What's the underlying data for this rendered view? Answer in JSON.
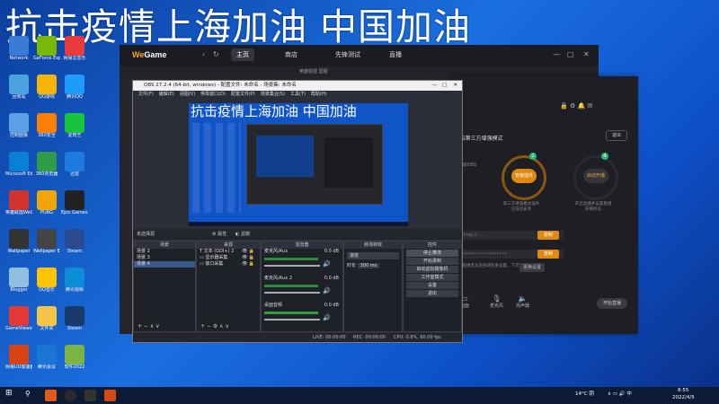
{
  "banner": "抗击疫情上海加油 中国加油",
  "desktop_icons": [
    {
      "label": "Network"
    },
    {
      "label": "GeForce Experience"
    },
    {
      "label": "网易云音乐"
    },
    {
      "label": "回收站"
    },
    {
      "label": "QQ游戏"
    },
    {
      "label": "腾讯QQ"
    },
    {
      "label": "控制面板"
    },
    {
      "label": "360安全"
    },
    {
      "label": "爱奇艺"
    },
    {
      "label": "Microsoft Edge"
    },
    {
      "label": "360浏览器"
    },
    {
      "label": "迅雷"
    },
    {
      "label": "英雄联盟WeGame"
    },
    {
      "label": "PUBG"
    },
    {
      "label": "Epic Games Launcher"
    },
    {
      "label": "Wallpaper"
    },
    {
      "label": "Wallpaper Engine"
    },
    {
      "label": "Steam"
    },
    {
      "label": "Blogger"
    },
    {
      "label": "QQ音乐"
    },
    {
      "label": "腾讯视频"
    },
    {
      "label": "GameViewer"
    },
    {
      "label": "文件夹"
    },
    {
      "label": "Steam"
    },
    {
      "label": "网易UU加速器"
    },
    {
      "label": "腾讯会议"
    },
    {
      "label": "软件2022"
    }
  ],
  "wegame": {
    "logo_we": "We",
    "logo_game": "Game",
    "tabs": [
      {
        "label": "主页"
      },
      {
        "label": "商店"
      },
      {
        "label": "先锋测试"
      },
      {
        "label": "直播"
      }
    ],
    "sub_label": "英雄联盟 国服",
    "controls": [
      "—",
      "□",
      "✕"
    ]
  },
  "panel": {
    "title": "OBS第三方增强模式",
    "exit": "退出",
    "steps": [
      {
        "num": "2",
        "label": "安装插件",
        "desc": "第三方增强模式插件\n已成功安装"
      },
      {
        "num": "4",
        "label": "启动开播",
        "desc": "开启直播并设置直播\n开播状态"
      }
    ],
    "step1_desc": "开启OBS",
    "server_placeholder": "rtmp://....",
    "key_placeholder": "•••••••••••••••••",
    "copy1": "复制",
    "copy2": "复制",
    "hint": "若直播无法连接请检查设置，下次无需重复复制",
    "settings_btn": "更换设置",
    "footer": [
      {
        "label": "画面"
      },
      {
        "label": "麦克风"
      },
      {
        "label": "扬声器"
      }
    ],
    "start": "开始直播"
  },
  "obs": {
    "title": "OBS 27.2.4 (64-bit, windows) - 配置文件: 未命名 - 场景集: 未命名",
    "menu": [
      "文件(F)",
      "编辑(E)",
      "视图(V)",
      "停靠窗口(D)",
      "配置文件(P)",
      "场景集合(S)",
      "工具(T)",
      "帮助(H)"
    ],
    "preview_banner": "抗击疫情上海加油 中国加油",
    "bar_left": "未选择源",
    "bar_props": "属性",
    "bar_filters": "滤镜",
    "docks": {
      "scenes": {
        "title": "场景",
        "items": [
          "场景 2",
          "场景 3",
          "场景 4"
        ]
      },
      "sources": {
        "title": "来源",
        "items": [
          "文本 (GDI+) 2",
          "显示器采集",
          "窗口采集"
        ]
      },
      "mixer": {
        "title": "混音器",
        "items": [
          {
            "name": "麦克风/Aux",
            "db": "0.0 dB"
          },
          {
            "name": "麦克风/Aux 2",
            "db": "0.0 dB"
          },
          {
            "name": "桌面音频",
            "db": "0.0 dB"
          }
        ]
      },
      "transitions": {
        "title": "转场特效",
        "mode": "渐变",
        "duration_label": "时长",
        "duration": "300 ms"
      },
      "controls": {
        "title": "控件",
        "buttons": [
          "停止推流",
          "开始录制",
          "启动虚拟摄像机",
          "工作室模式",
          "设置",
          "退出"
        ]
      }
    },
    "status": {
      "live": "LIVE: 00:00:00",
      "rec": "REC: 00:00:00",
      "cpu": "CPU: 0.9%, 60.00 fps"
    }
  },
  "taskbar": {
    "weather": "14°C 阴",
    "time": "8:55",
    "date": "2022/4/5"
  }
}
